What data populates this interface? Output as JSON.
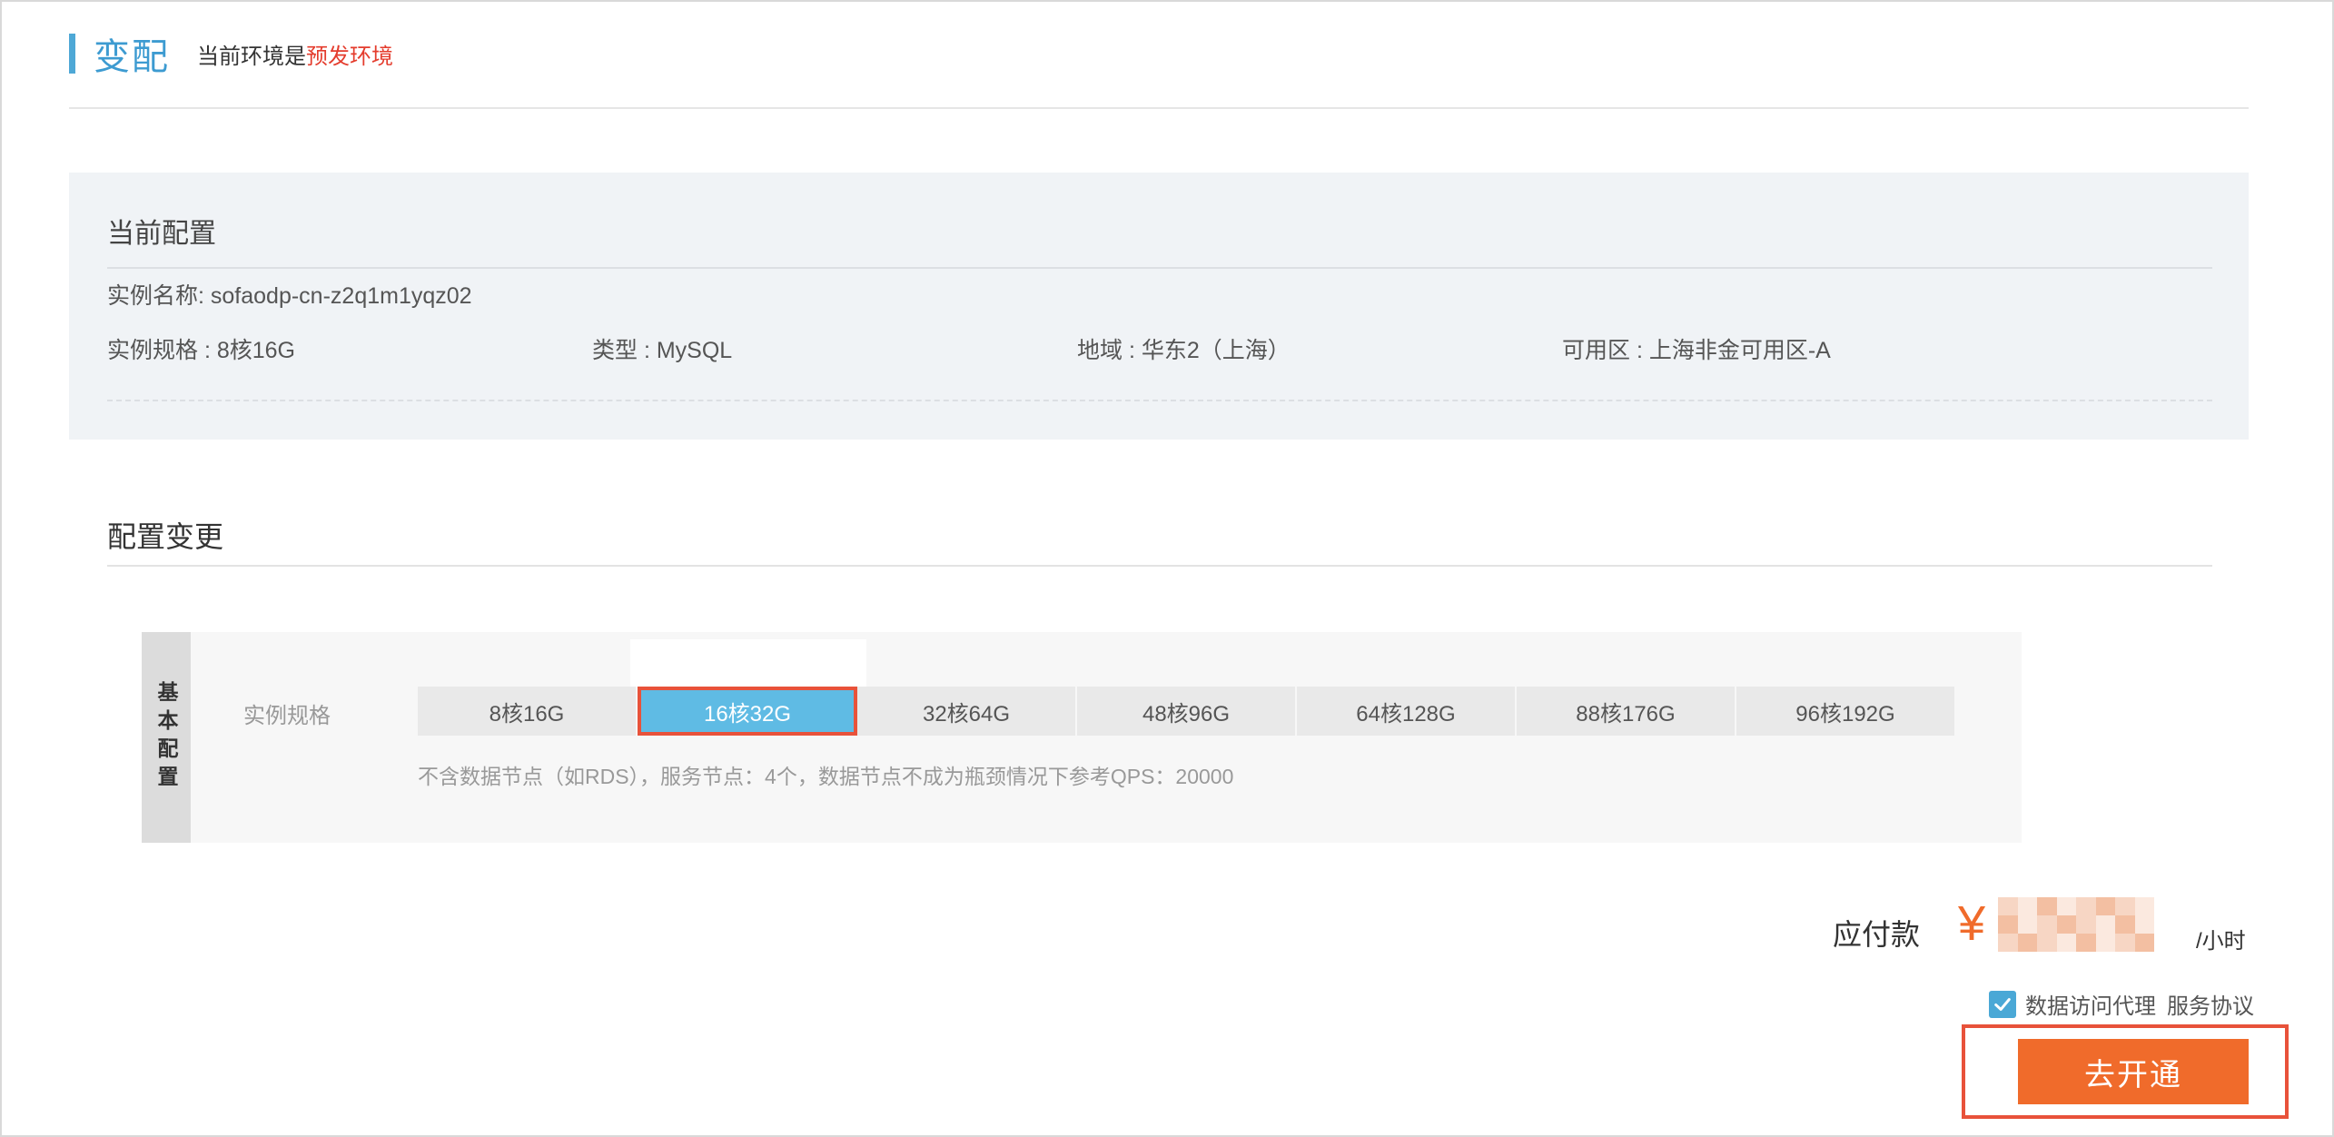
{
  "header": {
    "title": "变配",
    "env_prefix": "当前环境是",
    "env_name": "预发环境"
  },
  "current_config": {
    "title": "当前配置",
    "instance_name": "实例名称: sofaodp-cn-z2q1m1yqz02",
    "spec": "实例规格 : 8核16G",
    "type": "类型 : MySQL",
    "region": "地域 : 华东2（上海）",
    "zone": "可用区 : 上海非金可用区-A"
  },
  "config_change": {
    "title": "配置变更",
    "section_label": "基本配置",
    "row_label": "实例规格",
    "options": [
      "8核16G",
      "16核32G",
      "32核64G",
      "48核96G",
      "64核128G",
      "88核176G",
      "96核192G"
    ],
    "selected": "16核32G",
    "note": "不含数据节点（如RDS），服务节点：4个，数据节点不成为瓶颈情况下参考QPS：20000"
  },
  "payment": {
    "label": "应付款",
    "currency": "¥",
    "unit": "/小时",
    "agreement_checked": true,
    "agreement_text": "数据访问代理",
    "agreement_link": "服务协议",
    "submit_label": "去开通"
  },
  "colors": {
    "accent_blue": "#3d9bd1",
    "selected_option": "#5fbbe4",
    "env_red": "#e43c2d",
    "button_orange": "#f06b2b",
    "highlight_outline": "#e8523a"
  }
}
